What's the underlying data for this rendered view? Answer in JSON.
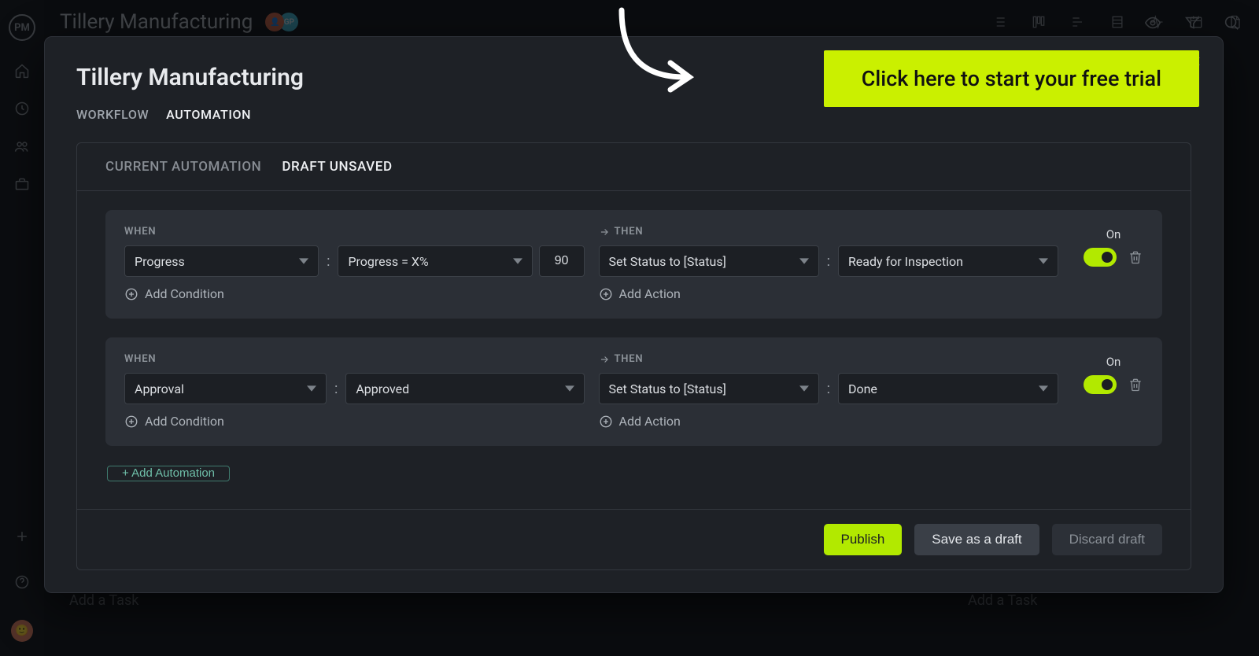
{
  "app_title": "Tillery Manufacturing",
  "avatars": {
    "a1": "👤",
    "a2": "GP"
  },
  "bg_add_task": "Add a Task",
  "modal": {
    "title": "Tillery Manufacturing",
    "tabs": {
      "workflow": "WORKFLOW",
      "automation": "AUTOMATION"
    }
  },
  "panel_tabs": {
    "current": "CURRENT AUTOMATION",
    "draft": "DRAFT UNSAVED"
  },
  "labels": {
    "when": "WHEN",
    "then": "THEN",
    "add_condition": "Add Condition",
    "add_action": "Add Action",
    "on": "On",
    "add_automation": "+ Add Automation"
  },
  "automations": [
    {
      "when_field": "Progress",
      "when_op": "Progress = X%",
      "when_value": "90",
      "then_action": "Set Status to [Status]",
      "then_value": "Ready for Inspection"
    },
    {
      "when_field": "Approval",
      "when_op": "Approved",
      "when_value": "",
      "then_action": "Set Status to [Status]",
      "then_value": "Done"
    }
  ],
  "footer": {
    "publish": "Publish",
    "save_draft": "Save as a draft",
    "discard": "Discard draft"
  },
  "cta": "Click here to start your free trial"
}
